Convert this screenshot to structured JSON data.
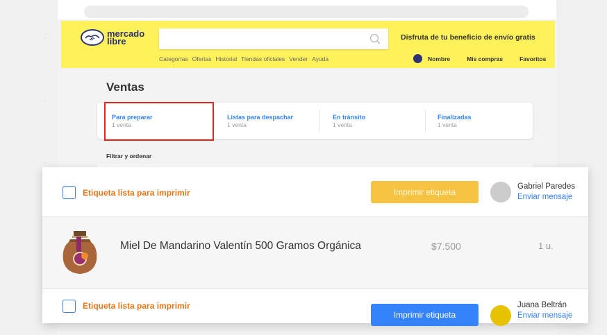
{
  "header": {
    "logo_line1": "mercado",
    "logo_line2": "libre",
    "promo": "Disfruta de tu beneficio de envío gratis",
    "nav_links": [
      "Categorías",
      "Ofertas",
      "Historial",
      "Tiendas oficiales",
      "Vender",
      "Ayuda"
    ],
    "user_name": "Nombre",
    "my_purchases": "Mis compras",
    "favorites": "Favoritos"
  },
  "ventas": {
    "title": "Ventas",
    "tabs": [
      {
        "label": "Para preparar",
        "count": "1 venta"
      },
      {
        "label": "Listas para despachar",
        "count": "1 venta"
      },
      {
        "label": "En tránsito",
        "count": "1 venta"
      },
      {
        "label": "Finalizadas",
        "count": "1 venta"
      }
    ],
    "filter_label": "Filtrar y ordenar"
  },
  "orders": [
    {
      "label": "Etiqueta lista para imprimir",
      "button": "Imprimir etiqueta",
      "buyer": "Gabriel Paredes",
      "message": "Enviar mensaje",
      "avatar_color": "#cccccc",
      "button_state": "disabled"
    },
    {
      "label": "Etiqueta lista para imprimir",
      "button": "Imprimir etiqueta",
      "buyer": "Juana Beltrán",
      "message": "Enviar mensaje",
      "avatar_color": "#e6c200",
      "button_state": "active"
    }
  ],
  "product": {
    "title": "Miel De Mandarino Valentín 500 Gramos Orgánica",
    "price": "$7.500",
    "quantity": "1 u."
  },
  "colors": {
    "brand_yellow": "#fff159",
    "brand_blue": "#2d3277",
    "link_blue": "#3483fa",
    "orange_label": "#e3761b",
    "highlight_red": "#e3261b"
  }
}
